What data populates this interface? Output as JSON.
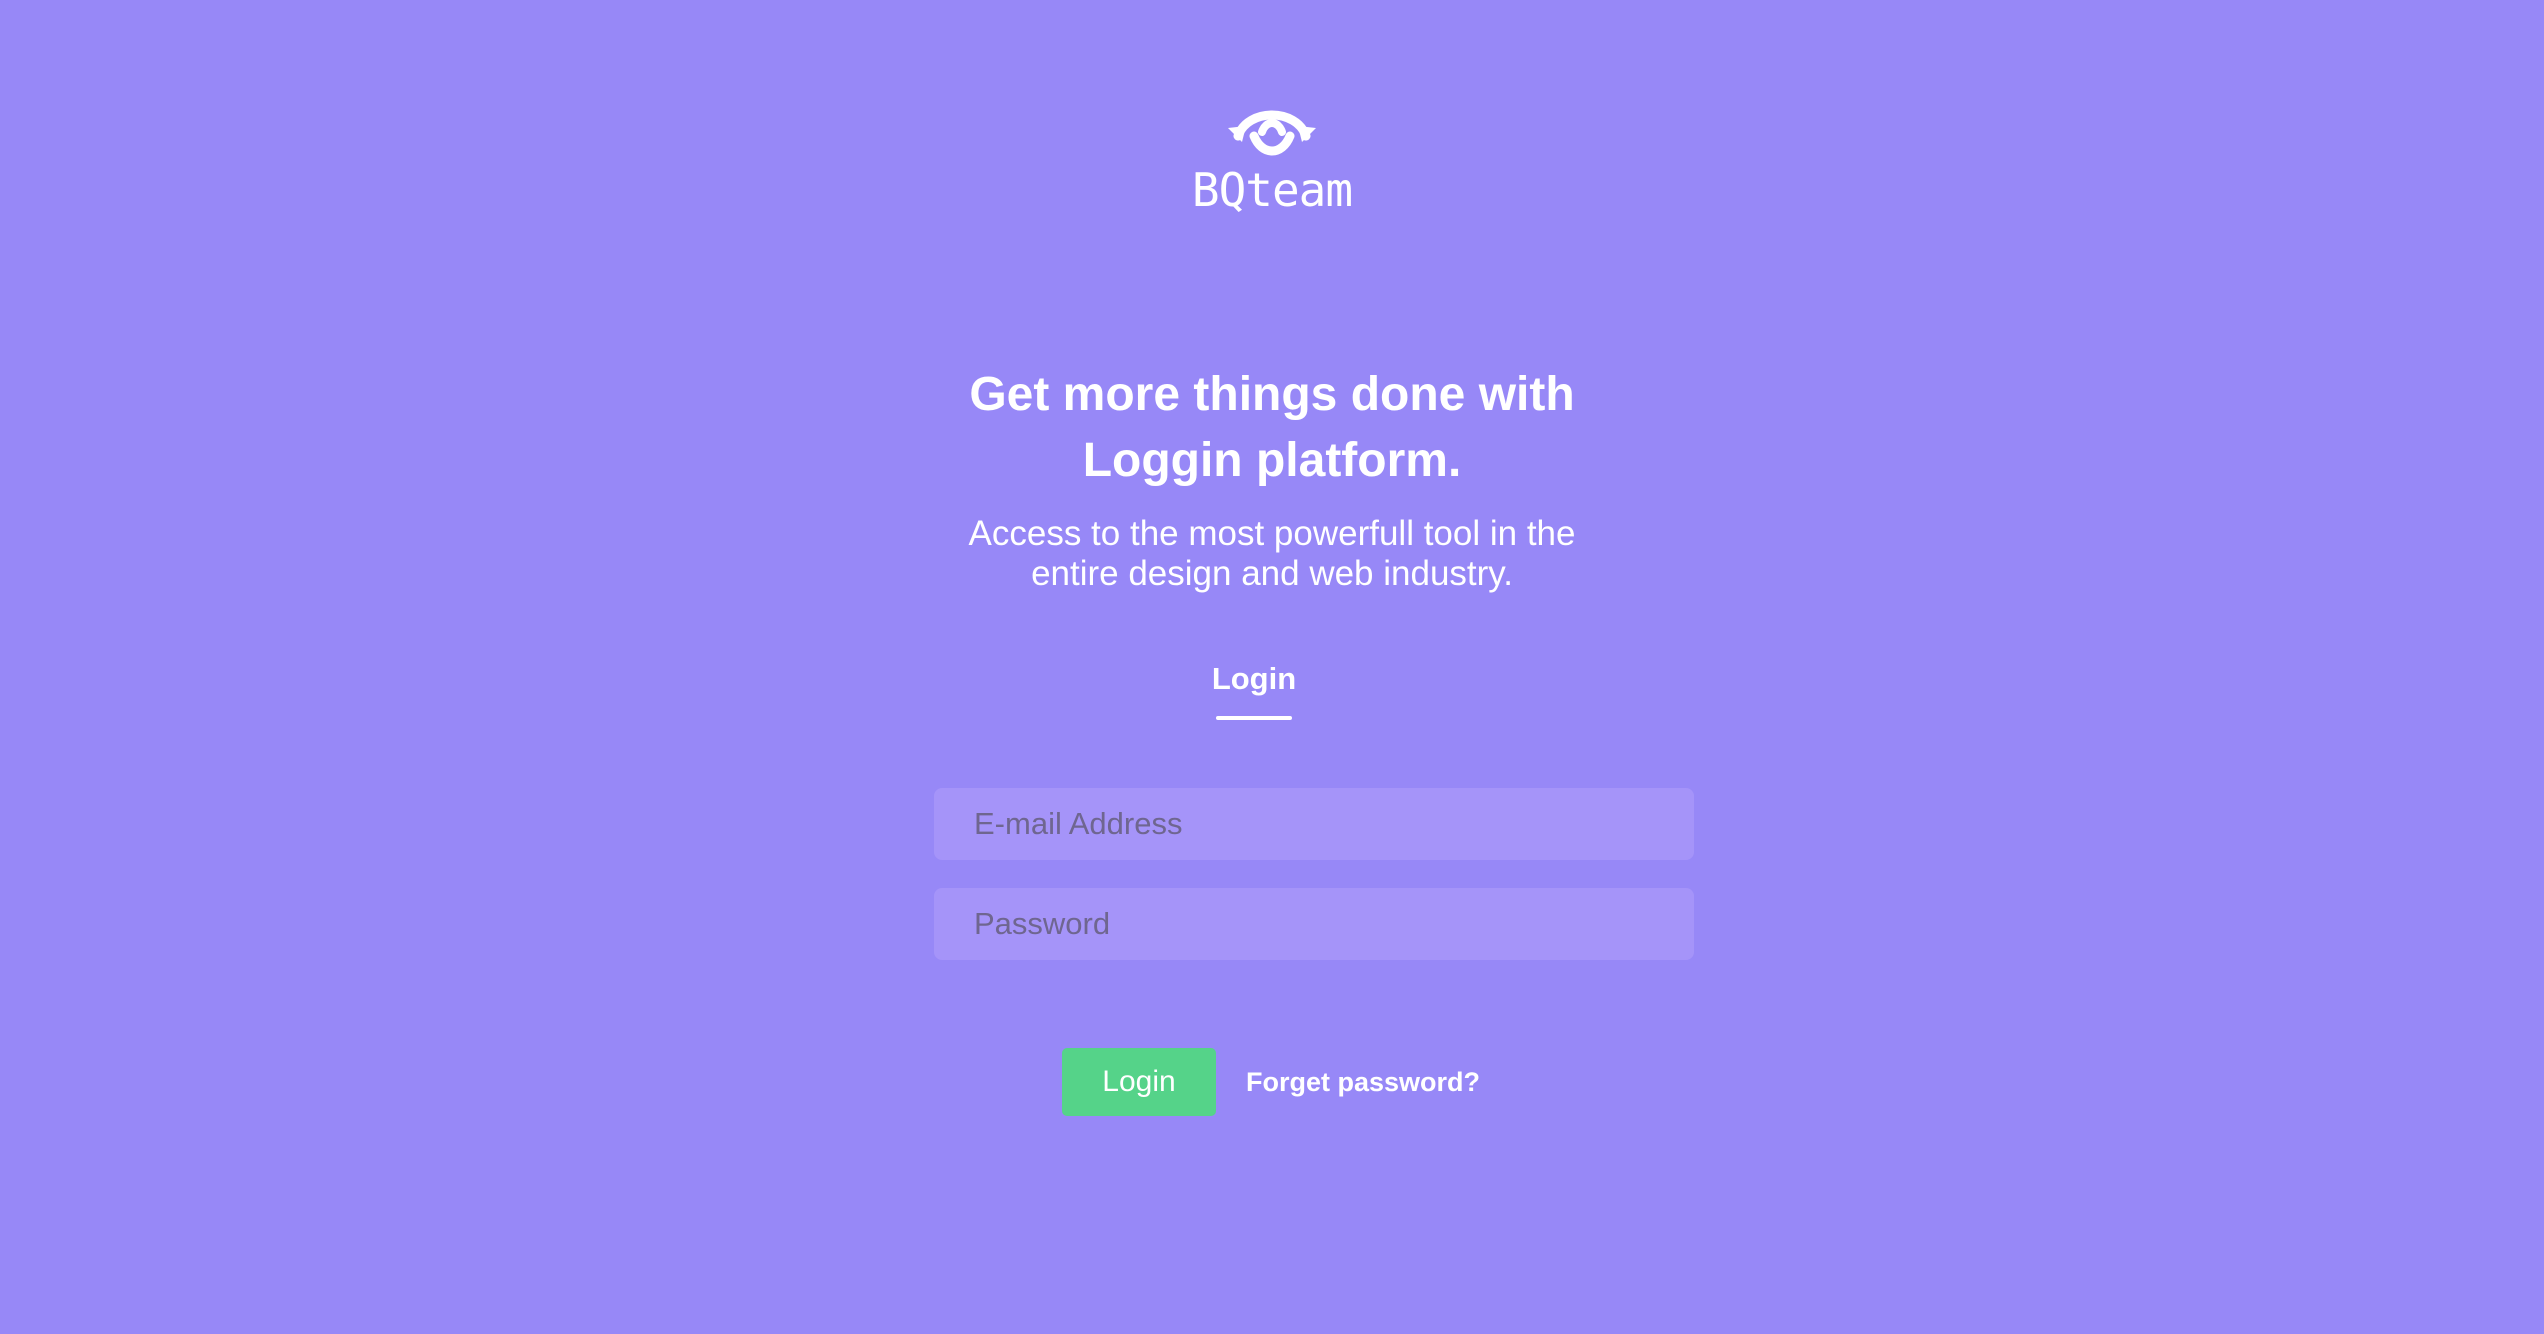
{
  "brand": {
    "logo_icon": "eye-sync-icon",
    "name": "BQteam"
  },
  "hero": {
    "headline_line1": "Get more things done with",
    "headline_line2": "Loggin platform.",
    "subtitle_line1": "Access to the most powerfull tool in the",
    "subtitle_line2": "entire design and web industry."
  },
  "tabs": [
    {
      "label": "Login",
      "active": true
    }
  ],
  "form": {
    "email": {
      "placeholder": "E-mail Address",
      "value": ""
    },
    "password": {
      "placeholder": "Password",
      "value": ""
    },
    "submit_label": "Login",
    "forgot_label": "Forget password?"
  },
  "colors": {
    "background": "#9788f7",
    "input_background": "#a594f9",
    "button": "#55d389",
    "text": "#ffffff"
  }
}
